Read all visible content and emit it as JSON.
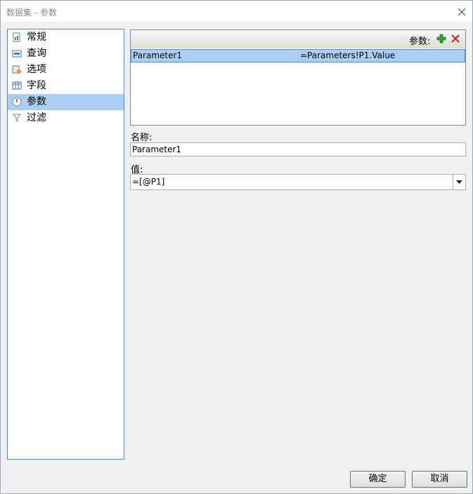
{
  "window": {
    "title": "数据集 - 参数"
  },
  "sidebar": {
    "items": [
      {
        "label": "常规",
        "icon": "report-icon",
        "selected": false
      },
      {
        "label": "查询",
        "icon": "database-query-icon",
        "selected": false
      },
      {
        "label": "选项",
        "icon": "options-icon",
        "selected": false
      },
      {
        "label": "字段",
        "icon": "fields-icon",
        "selected": false
      },
      {
        "label": "参数",
        "icon": "parameter-icon",
        "selected": true
      },
      {
        "label": "过滤",
        "icon": "filter-icon",
        "selected": false
      }
    ]
  },
  "params": {
    "toolbar_label": "参数:",
    "rows": [
      {
        "name": "Parameter1",
        "value": "=Parameters!P1.Value",
        "selected": true
      }
    ]
  },
  "form": {
    "name_label": "名称:",
    "name_value": "Parameter1",
    "value_label": "值:",
    "value_value": "=[@P1]"
  },
  "buttons": {
    "ok": "确定",
    "cancel": "取消"
  },
  "colors": {
    "selection": "#aacff2",
    "add_icon": "#2fa52f",
    "delete_icon": "#e02424",
    "nav_border": "#4a8fd6"
  }
}
